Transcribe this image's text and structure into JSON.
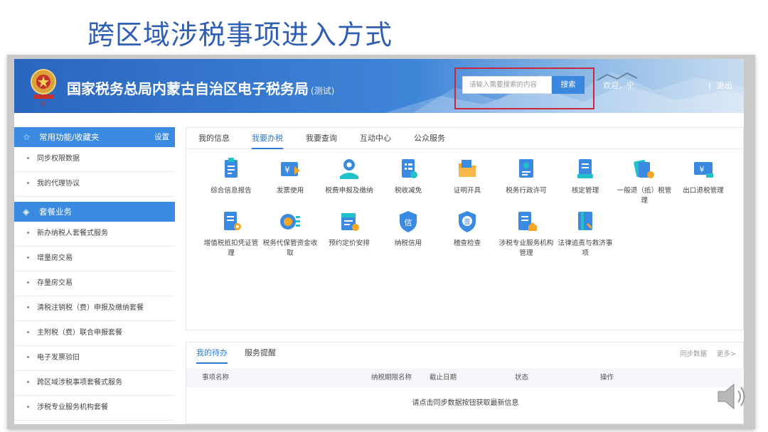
{
  "slide": {
    "title": "跨区域涉税事项进入方式"
  },
  "header": {
    "site_name": "国家税务总局内蒙古自治区电子税务局",
    "site_tag": "(测试)",
    "search_placeholder": "请输入需要搜索的内容",
    "search_button": "搜索",
    "welcome": "欢迎，宁",
    "logout": "退出",
    "logout_sep": "|"
  },
  "sidebar": {
    "favorites_title": "常用功能/收藏夹",
    "favorites_setting": "设置",
    "favorites": [
      "同步权限数据",
      "我的代理协议"
    ],
    "packages_title": "套餐业务",
    "packages": [
      "新办纳税人套餐式服务",
      "增量房交易",
      "存量房交易",
      "清税注销税（费）申报及缴纳套餐",
      "主附税（费）联合申报套餐",
      "电子发票验旧",
      "跨区域涉税事项套餐式服务",
      "涉税专业服务机构套餐"
    ]
  },
  "main": {
    "tabs": [
      "我的信息",
      "我要办税",
      "我要查询",
      "互动中心",
      "公众服务"
    ],
    "active_tab": "我要办税",
    "services_row1": [
      {
        "label": "综合信息报告",
        "icon": "report-icon"
      },
      {
        "label": "发票使用",
        "icon": "invoice-icon"
      },
      {
        "label": "税费申报及缴纳",
        "icon": "tax-declare-icon"
      },
      {
        "label": "税收减免",
        "icon": "tax-relief-icon"
      },
      {
        "label": "证明开具",
        "icon": "certificate-icon"
      },
      {
        "label": "税务行政许可",
        "icon": "license-icon"
      },
      {
        "label": "核定管理",
        "icon": "assessment-icon"
      },
      {
        "label": "一般退（抵）税管理",
        "icon": "refund-icon"
      },
      {
        "label": "出口退税管理",
        "icon": "export-refund-icon"
      }
    ],
    "services_row2": [
      {
        "label": "增值税抵扣凭证管理",
        "icon": "vat-voucher-icon"
      },
      {
        "label": "税务代保管资金收取",
        "icon": "custody-fund-icon"
      },
      {
        "label": "预约定价安排",
        "icon": "pricing-icon"
      },
      {
        "label": "纳税信用",
        "icon": "credit-icon"
      },
      {
        "label": "稽查检查",
        "icon": "inspection-icon"
      },
      {
        "label": "涉税专业服务机构管理",
        "icon": "agency-icon"
      },
      {
        "label": "法律追责与救济事项",
        "icon": "law-icon"
      }
    ],
    "service_icon_glyphs": {
      "invoice": "¥",
      "credit": "信",
      "inspection": "查",
      "export": "¥"
    }
  },
  "todo": {
    "tabs": [
      "我的待办",
      "服务提醒"
    ],
    "sync_label": "同步数据",
    "more_label": "更多>",
    "columns": [
      "事项名称",
      "纳税期限名称",
      "截止日期",
      "状态",
      "操作"
    ],
    "empty_text": "请点击同步数据按钮获取最新信息"
  },
  "colors": {
    "title": "#2f5fb3",
    "primary": "#3b8ae2",
    "highlight_box": "#c8283a",
    "active_tab": "#2d7ad6"
  }
}
